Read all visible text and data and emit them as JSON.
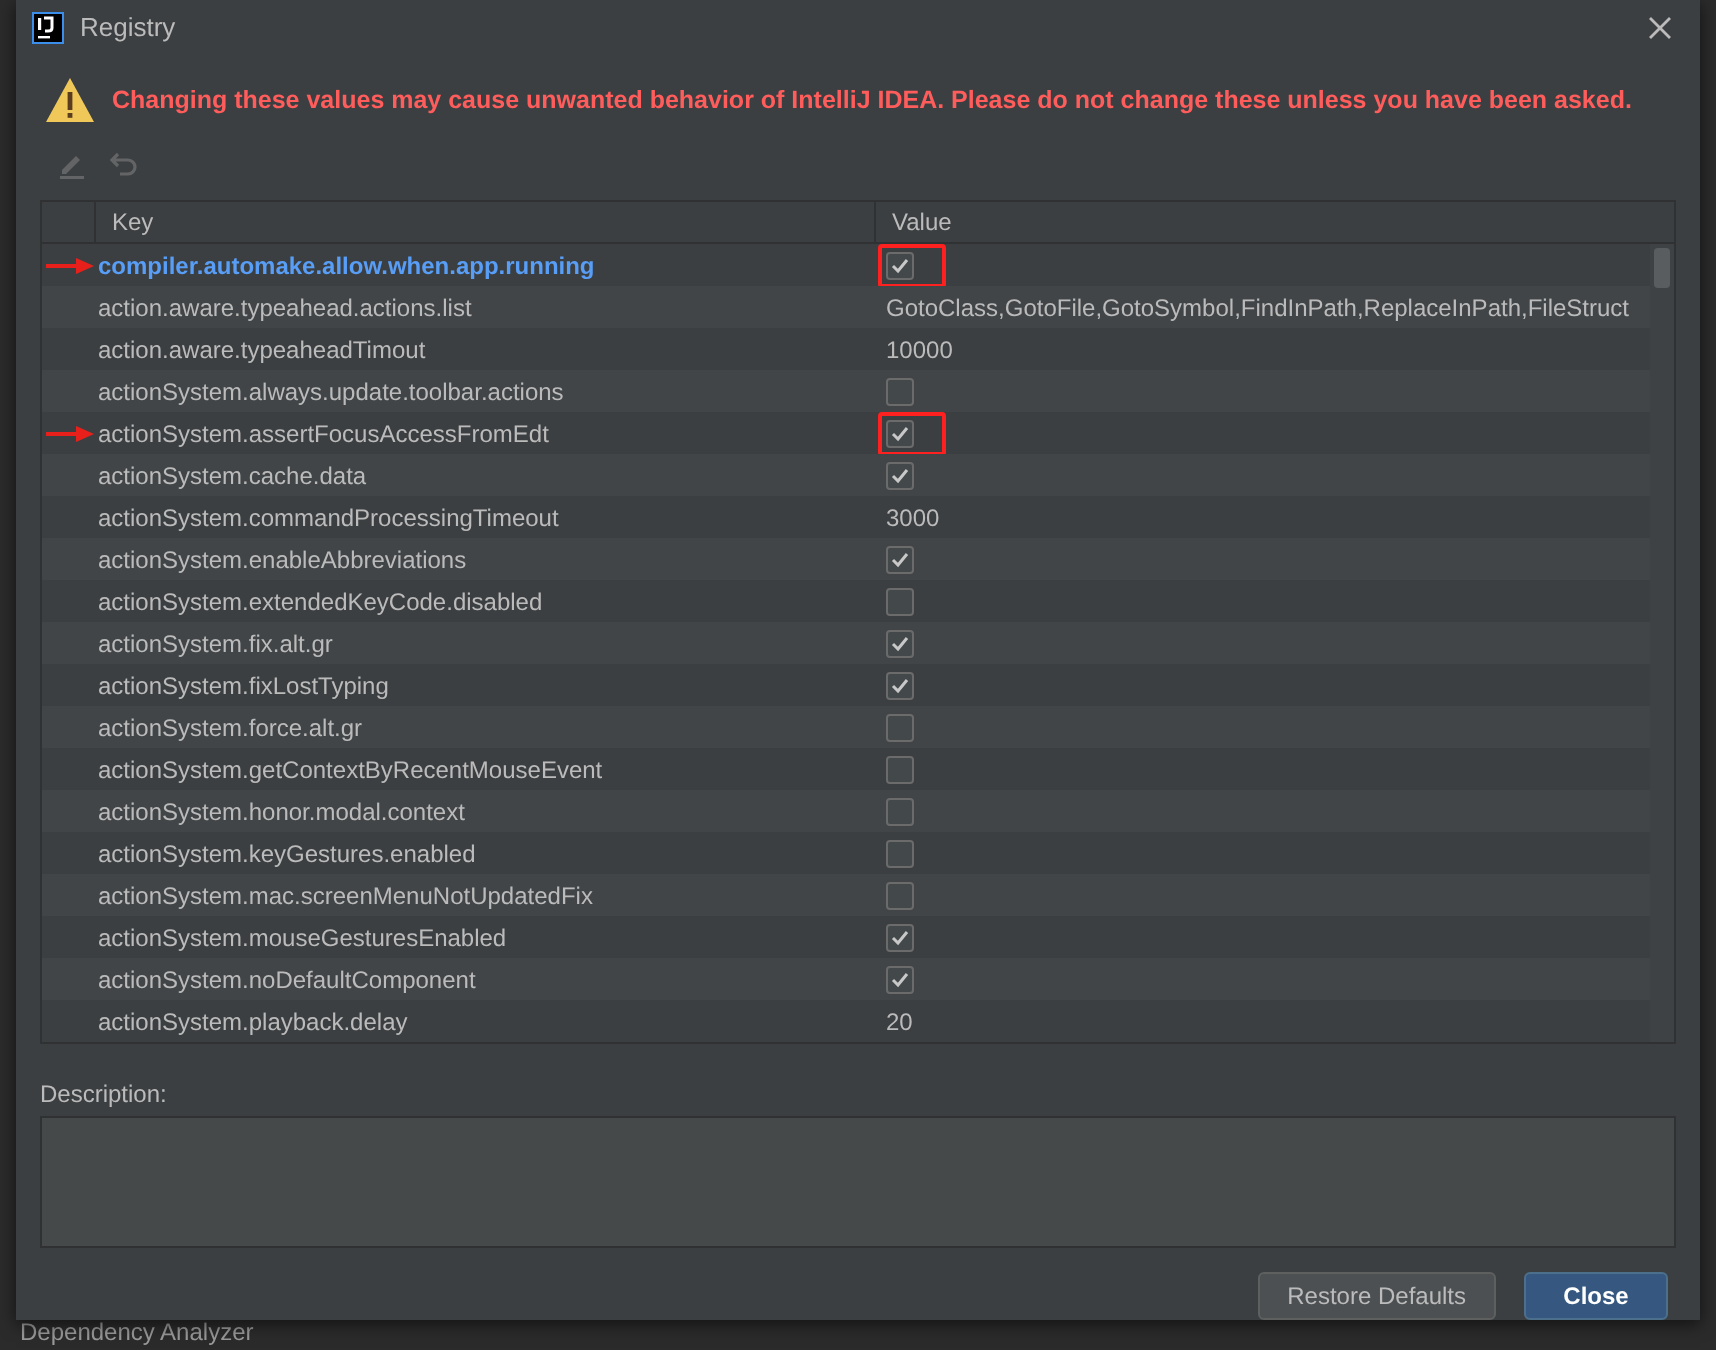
{
  "window": {
    "title": "Registry"
  },
  "warning": "Changing these values may cause unwanted behavior of IntelliJ IDEA. Please do not change these unless you have been asked.",
  "toolbar": [
    {
      "kind": "edit",
      "disabled": true
    },
    {
      "kind": "revert",
      "disabled": true
    }
  ],
  "table": {
    "columns": [
      "Key",
      "Value"
    ],
    "rows": [
      {
        "key": "compiler.automake.allow.when.app.running",
        "kind": "checkbox",
        "checked": true,
        "modified": true,
        "highlighted": true
      },
      {
        "key": "action.aware.typeahead.actions.list",
        "kind": "text",
        "value": "GotoClass,GotoFile,GotoSymbol,FindInPath,ReplaceInPath,FileStruct",
        "modified": false,
        "highlighted": false
      },
      {
        "key": "action.aware.typeaheadTimout",
        "kind": "text",
        "value": "10000",
        "modified": false,
        "highlighted": false
      },
      {
        "key": "actionSystem.always.update.toolbar.actions",
        "kind": "checkbox",
        "checked": false,
        "modified": false,
        "highlighted": false
      },
      {
        "key": "actionSystem.assertFocusAccessFromEdt",
        "kind": "checkbox",
        "checked": true,
        "modified": false,
        "highlighted": true
      },
      {
        "key": "actionSystem.cache.data",
        "kind": "checkbox",
        "checked": true,
        "modified": false,
        "highlighted": false
      },
      {
        "key": "actionSystem.commandProcessingTimeout",
        "kind": "text",
        "value": "3000",
        "modified": false,
        "highlighted": false
      },
      {
        "key": "actionSystem.enableAbbreviations",
        "kind": "checkbox",
        "checked": true,
        "modified": false,
        "highlighted": false
      },
      {
        "key": "actionSystem.extendedKeyCode.disabled",
        "kind": "checkbox",
        "checked": false,
        "modified": false,
        "highlighted": false
      },
      {
        "key": "actionSystem.fix.alt.gr",
        "kind": "checkbox",
        "checked": true,
        "modified": false,
        "highlighted": false
      },
      {
        "key": "actionSystem.fixLostTyping",
        "kind": "checkbox",
        "checked": true,
        "modified": false,
        "highlighted": false
      },
      {
        "key": "actionSystem.force.alt.gr",
        "kind": "checkbox",
        "checked": false,
        "modified": false,
        "highlighted": false
      },
      {
        "key": "actionSystem.getContextByRecentMouseEvent",
        "kind": "checkbox",
        "checked": false,
        "modified": false,
        "highlighted": false
      },
      {
        "key": "actionSystem.honor.modal.context",
        "kind": "checkbox",
        "checked": false,
        "modified": false,
        "highlighted": false
      },
      {
        "key": "actionSystem.keyGestures.enabled",
        "kind": "checkbox",
        "checked": false,
        "modified": false,
        "highlighted": false
      },
      {
        "key": "actionSystem.mac.screenMenuNotUpdatedFix",
        "kind": "checkbox",
        "checked": false,
        "modified": false,
        "highlighted": false
      },
      {
        "key": "actionSystem.mouseGesturesEnabled",
        "kind": "checkbox",
        "checked": true,
        "modified": false,
        "highlighted": false
      },
      {
        "key": "actionSystem.noDefaultComponent",
        "kind": "checkbox",
        "checked": true,
        "modified": false,
        "highlighted": false
      },
      {
        "key": "actionSystem.playback.delay",
        "kind": "text",
        "value": "20",
        "modified": false,
        "highlighted": false
      }
    ]
  },
  "description": {
    "label": "Description:"
  },
  "buttons": [
    {
      "label": "Restore Defaults",
      "primary": false
    },
    {
      "label": "Close",
      "primary": true
    }
  ],
  "background_label": "Dependency Analyzer"
}
